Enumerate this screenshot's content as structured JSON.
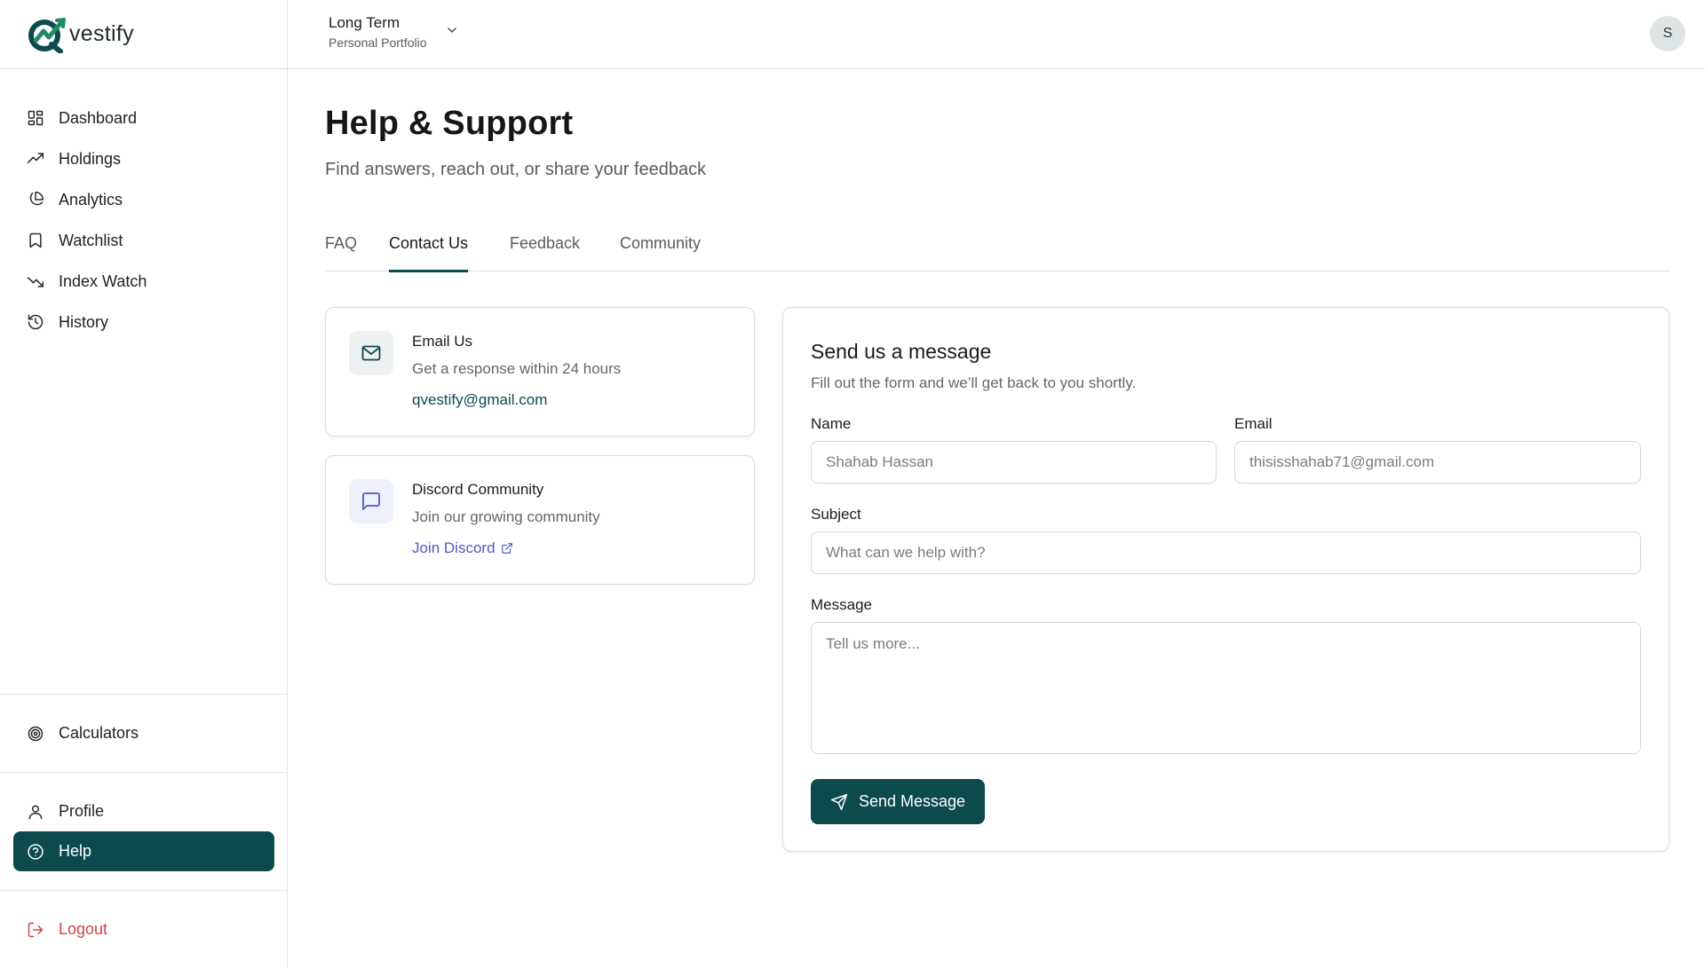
{
  "app": {
    "logo_text": "vestify",
    "logo_icon": "q-check-logo-icon",
    "accent_color": "#0c4a4e",
    "danger_color": "#d04444",
    "link_color": "#4a5bc4"
  },
  "sidebar": {
    "items": [
      {
        "label": "Dashboard",
        "icon": "grid-icon"
      },
      {
        "label": "Holdings",
        "icon": "trending-up-icon"
      },
      {
        "label": "Analytics",
        "icon": "pie-chart-icon"
      },
      {
        "label": "Watchlist",
        "icon": "bookmark-icon"
      },
      {
        "label": "Index Watch",
        "icon": "trending-down-icon"
      },
      {
        "label": "History",
        "icon": "history-icon"
      }
    ],
    "calculators": {
      "label": "Calculators",
      "icon": "target-icon"
    },
    "profile": {
      "label": "Profile",
      "icon": "user-icon"
    },
    "help": {
      "label": "Help",
      "icon": "help-circle-icon",
      "active": true
    },
    "logout": {
      "label": "Logout",
      "icon": "logout-icon"
    }
  },
  "topbar": {
    "portfolio_name": "Long Term",
    "portfolio_sub": "Personal Portfolio",
    "avatar_initial": "S"
  },
  "page": {
    "title": "Help & Support",
    "subtitle": "Find answers, reach out, or share your feedback"
  },
  "tabs": [
    {
      "label": "FAQ",
      "active": false
    },
    {
      "label": "Contact Us",
      "active": true
    },
    {
      "label": "Feedback",
      "active": false
    },
    {
      "label": "Community",
      "active": false
    }
  ],
  "contact_cards": [
    {
      "title": "Email Us",
      "description": "Get a response within 24 hours",
      "link": "qvestify@gmail.com",
      "icon": "mail-icon",
      "icon_bg": "#eef1f1",
      "icon_color": "#0c4a4e",
      "link_color": "#0c4a4e"
    },
    {
      "title": "Discord Community",
      "description": "Join our growing community",
      "link": "Join Discord",
      "icon": "message-square-icon",
      "icon_bg": "#eef0fb",
      "icon_color": "#4a5bc4",
      "link_color": "#4a5bc4"
    }
  ],
  "form": {
    "title": "Send us a message",
    "subtitle": "Fill out the form and we’ll get back to you shortly.",
    "name_label": "Name",
    "name_placeholder": "Shahab Hassan",
    "email_label": "Email",
    "email_placeholder": "thisisshahab71@gmail.com",
    "subject_label": "Subject",
    "subject_placeholder": "What can we help with?",
    "message_label": "Message",
    "message_placeholder": "Tell us more...",
    "submit_label": "Send Message"
  }
}
